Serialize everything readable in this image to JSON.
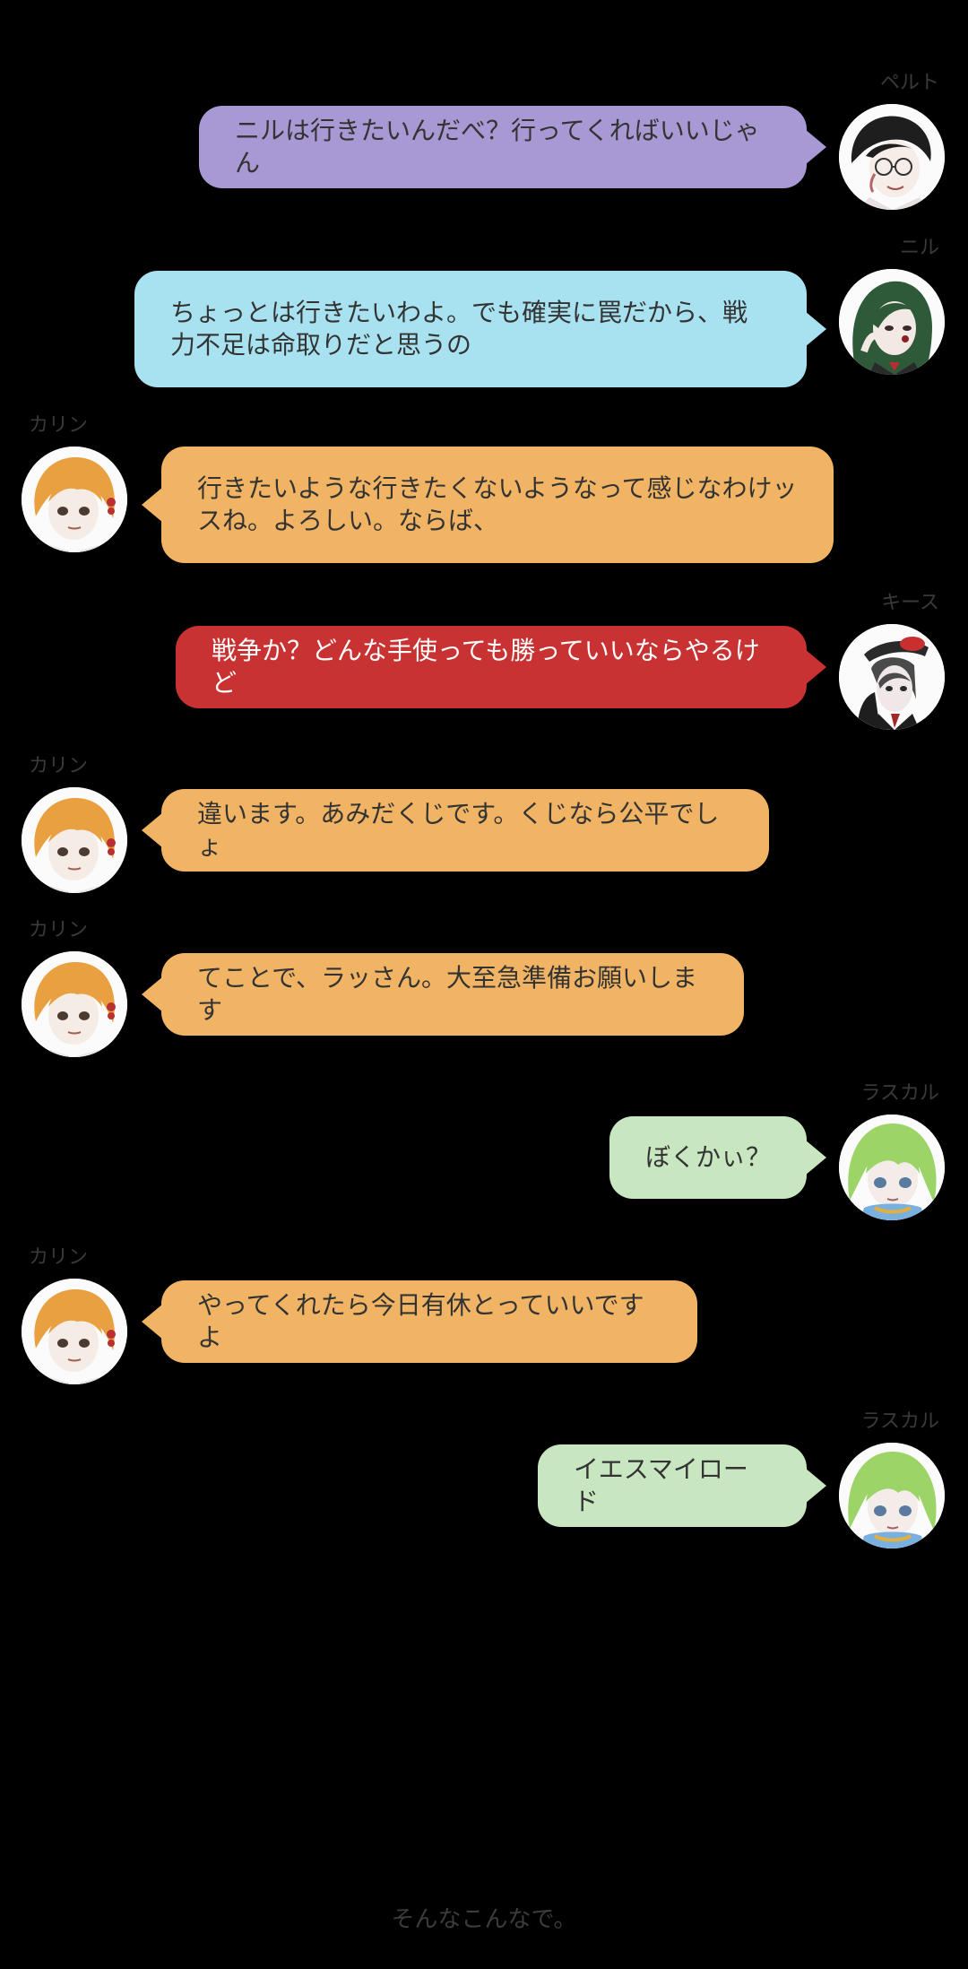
{
  "messages": [
    {
      "speaker": "ペルト",
      "text": "ニルは行きたいんだべ？行ってくればいいじゃん",
      "side": "right",
      "color": "#a898d4",
      "avatar": "pelt-avatar"
    },
    {
      "speaker": "ニル",
      "text": "ちょっとは行きたいわよ。でも確実に罠だから、戦力不足は命取りだと思うの",
      "side": "right",
      "color": "#a8e2f0",
      "avatar": "nil-avatar"
    },
    {
      "speaker": "カリン",
      "text": "行きたいような行きたくないようなって感じなわけッスね。よろしい。ならば、",
      "side": "left",
      "color": "#f0b464",
      "avatar": "karin-avatar"
    },
    {
      "speaker": "キース",
      "text": "戦争か？どんな手使っても勝っていいならやるけど",
      "side": "right",
      "color": "#c83232",
      "textColor": "#ffffff",
      "avatar": "keith-avatar"
    },
    {
      "speaker": "カリン",
      "text": "違います。あみだくじです。くじなら公平でしょ",
      "side": "left",
      "color": "#f0b464",
      "avatar": "karin-avatar"
    },
    {
      "speaker": "カリン",
      "text": "てことで、ラッさん。大至急準備お願いします",
      "side": "left",
      "color": "#f0b464",
      "avatar": "karin-avatar"
    },
    {
      "speaker": "ラスカル",
      "text": "ぼくかぃ？",
      "side": "right",
      "color": "#c8e6c0",
      "avatar": "rascal-avatar"
    },
    {
      "speaker": "カリン",
      "text": "やってくれたら今日有休とっていいですよ",
      "side": "left",
      "color": "#f0b464",
      "avatar": "karin-avatar"
    },
    {
      "speaker": "ラスカル",
      "text": "イエスマイロード",
      "side": "right",
      "color": "#c8e6c0",
      "avatar": "rascal-avatar"
    }
  ],
  "footer": "そんなこんなで。"
}
